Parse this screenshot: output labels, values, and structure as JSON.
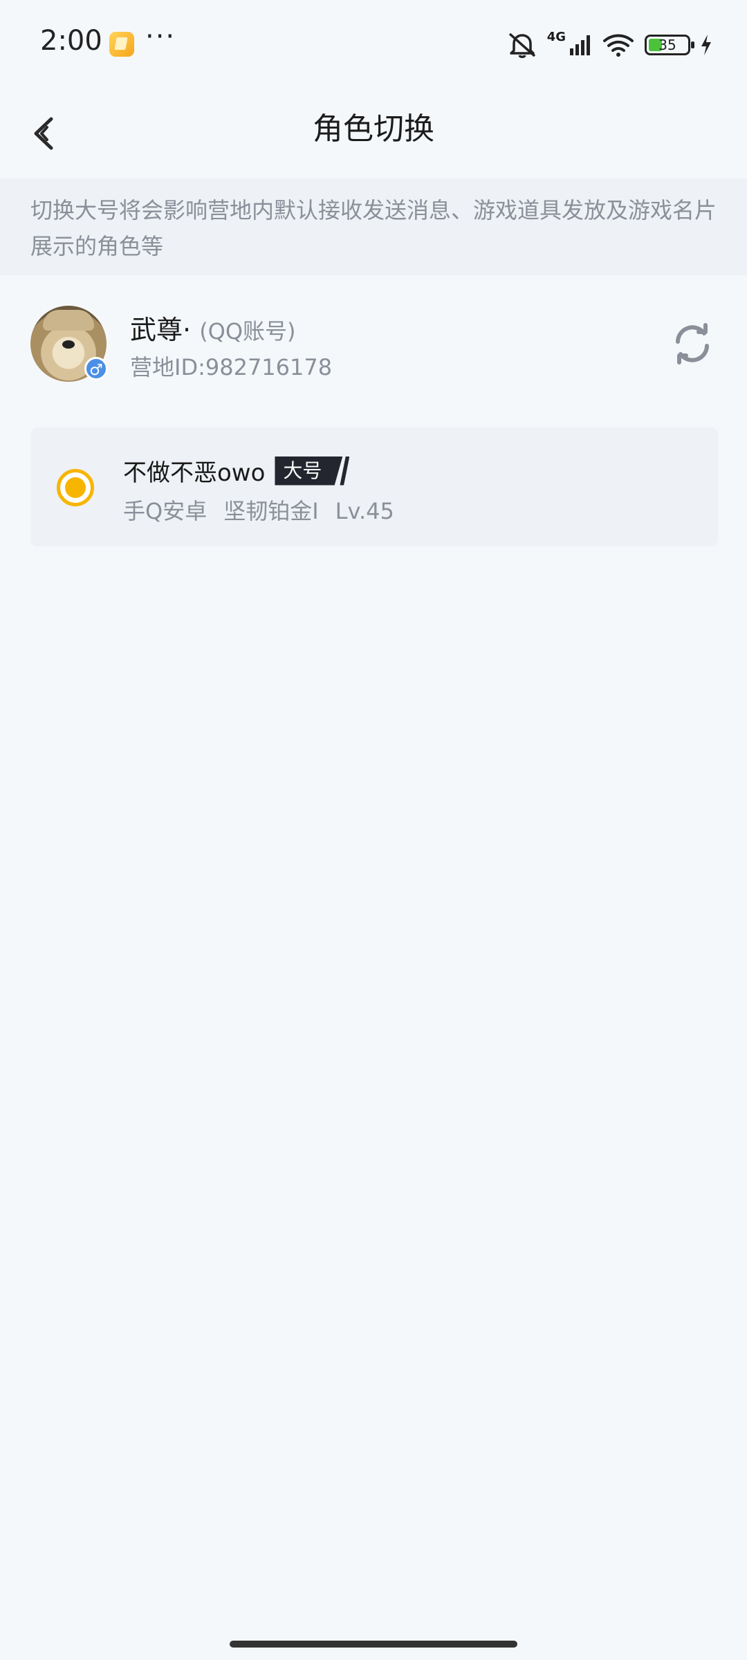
{
  "status_bar": {
    "time": "2:00",
    "dots": "···",
    "network": "4G",
    "battery_pct": "35",
    "battery_level": 0.35
  },
  "header": {
    "title": "角色切换"
  },
  "notice": {
    "text": "切换大号将会影响营地内默认接收发送消息、游戏道具发放及游戏名片展示的角色等"
  },
  "account": {
    "name": "武尊·",
    "type": "(QQ账号)",
    "id_text": "营地ID:982716178",
    "gender_symbol": "♂"
  },
  "roles": [
    {
      "name": "不做不恶owo",
      "tag": "大号",
      "platform": "手Q安卓",
      "rank": "坚韧铂金I",
      "level": "Lv.45",
      "selected": true
    }
  ]
}
